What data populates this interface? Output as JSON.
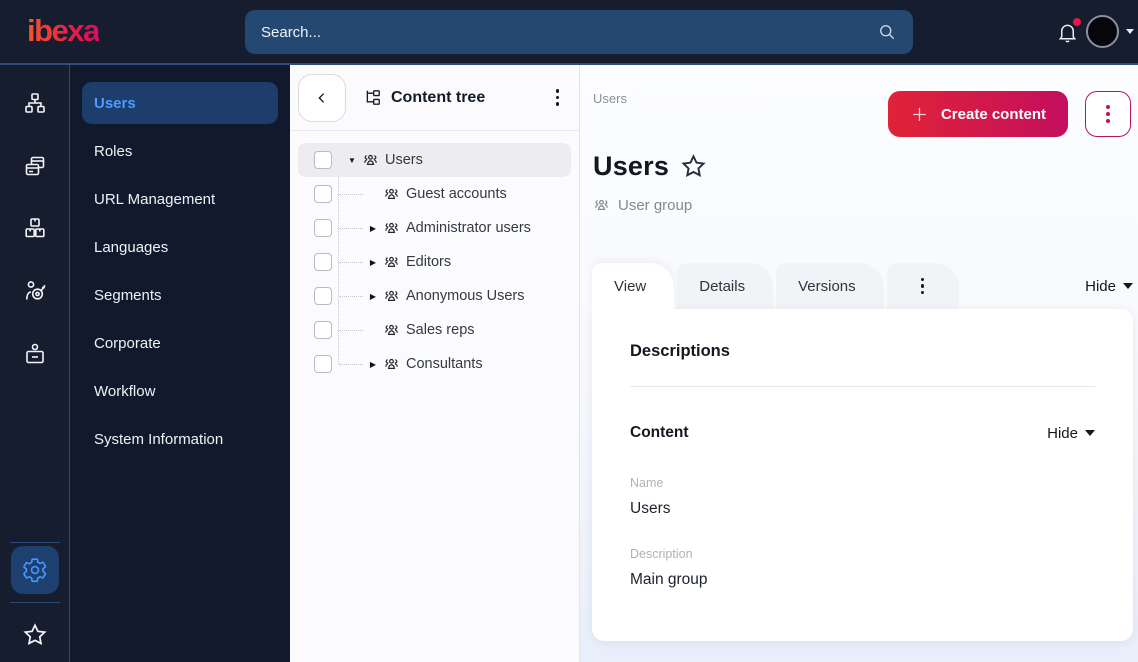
{
  "topbar": {
    "logo_text": "ibexa",
    "search_placeholder": "Search...",
    "icons": [
      "search-icon",
      "bell-icon",
      "user-avatar",
      "caret-down-icon"
    ],
    "notification_dot_color": "#e8174b"
  },
  "icon_rail": {
    "icons": [
      "sitemap-icon",
      "pages-icon",
      "boxes-icon",
      "personalization-target-icon",
      "badge-icon",
      "settings-gear-icon",
      "bookmarks-star-icon"
    ],
    "active_icon": "settings-gear-icon"
  },
  "sidebar": {
    "items": [
      {
        "label": "Users",
        "active": true
      },
      {
        "label": "Roles"
      },
      {
        "label": "URL Management"
      },
      {
        "label": "Languages"
      },
      {
        "label": "Segments"
      },
      {
        "label": "Corporate"
      },
      {
        "label": "Workflow"
      },
      {
        "label": "System Information"
      }
    ]
  },
  "content_tree": {
    "title": "Content tree",
    "items": [
      {
        "label": "Users",
        "arrow": "expanded",
        "selected": true,
        "level": "0"
      },
      {
        "label": "Guest accounts",
        "arrow": "none",
        "level": "1"
      },
      {
        "label": "Administrator users",
        "arrow": "collapsed",
        "level": "1"
      },
      {
        "label": "Editors",
        "arrow": "collapsed",
        "level": "1"
      },
      {
        "label": "Anonymous Users",
        "arrow": "collapsed",
        "level": "1"
      },
      {
        "label": "Sales reps",
        "arrow": "none",
        "level": "1"
      },
      {
        "label": "Consultants",
        "arrow": "collapsed",
        "level": "1"
      }
    ]
  },
  "main": {
    "breadcrumb": "Users",
    "create_button": "Create content",
    "title": "Users",
    "content_type": "User group",
    "tabs": [
      {
        "label": "View",
        "active": true
      },
      {
        "label": "Details"
      },
      {
        "label": "Versions"
      }
    ],
    "hide_toggle": "Hide",
    "card": {
      "section_title": "Descriptions",
      "subsection_title": "Content",
      "hide_toggle": "Hide",
      "fields": [
        {
          "label": "Name",
          "value": "Users"
        },
        {
          "label": "Description",
          "value": "Main group"
        }
      ]
    }
  },
  "colors": {
    "topbar_bg": "#161d2f",
    "sidebar_bg": "#111a2d",
    "accent_blue": "#4c9bff",
    "brand_gradient_start": "#e02337",
    "brand_gradient_end": "#c30f5e",
    "selected_row_bg": "#ececf1"
  }
}
